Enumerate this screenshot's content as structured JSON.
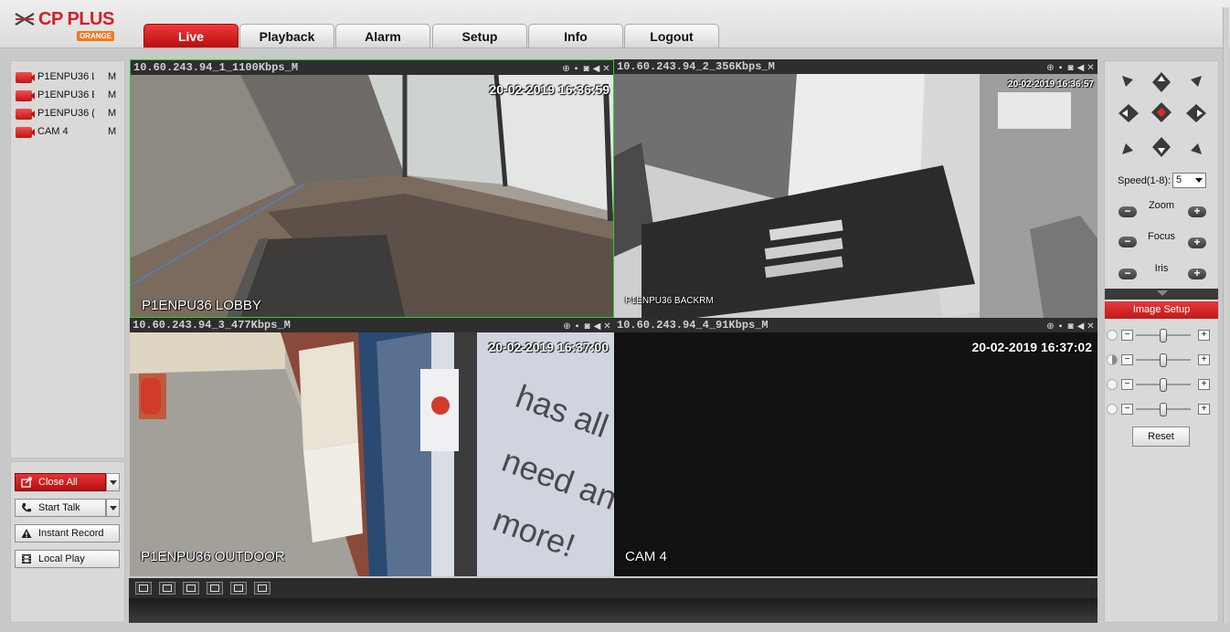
{
  "brand": {
    "name": "CP PLUS",
    "sub": "ORANGE"
  },
  "tabs": [
    {
      "label": "Live",
      "active": true
    },
    {
      "label": "Playback",
      "active": false
    },
    {
      "label": "Alarm",
      "active": false
    },
    {
      "label": "Setup",
      "active": false
    },
    {
      "label": "Info",
      "active": false
    },
    {
      "label": "Logout",
      "active": false
    }
  ],
  "cameras": [
    {
      "name": "P1ENPU36 L",
      "stream": "M",
      "icon": "camera-icon"
    },
    {
      "name": "P1ENPU36 E",
      "stream": "M",
      "icon": "camera-icon"
    },
    {
      "name": "P1ENPU36 (",
      "stream": "M",
      "icon": "camera-icon"
    },
    {
      "name": "CAM 4",
      "stream": "M",
      "icon": "camera-icon"
    }
  ],
  "controls": {
    "close_all": "Close All",
    "start_talk": "Start Talk",
    "instant_record": "Instant Record",
    "local_play": "Local Play"
  },
  "video": [
    {
      "header": "10.60.243.94_1_1100Kbps_M",
      "timestamp": "20-02-2019 16:36:59",
      "osd": "P1ENPU36 LOBBY",
      "selected": true
    },
    {
      "header": "10.60.243.94_2_356Kbps_M",
      "timestamp": "20-02-2019 16:36:57",
      "osd": "P1ENPU36 BACKRM",
      "selected": false
    },
    {
      "header": "10.60.243.94_3_477Kbps_M",
      "timestamp": "20-02-2019 16:37:00",
      "osd": "P1ENPU36 OUTDOOR",
      "selected": false
    },
    {
      "header": "10.60.243.94_4_91Kbps_M",
      "timestamp": "20-02-2019 16:37:02",
      "osd": "CAM 4",
      "selected": false
    }
  ],
  "ptz": {
    "speed_label": "Speed(1-8):",
    "speed_value": "5",
    "zoom": "Zoom",
    "focus": "Focus",
    "iris": "Iris"
  },
  "image_setup": {
    "title": "Image Setup",
    "sliders": [
      {
        "name": "brightness",
        "icon": "brightness-icon",
        "level": 0.5
      },
      {
        "name": "contrast",
        "icon": "contrast-icon",
        "level": 0.5
      },
      {
        "name": "saturation",
        "icon": "saturation-icon",
        "level": 0.5
      },
      {
        "name": "hue",
        "icon": "hue-icon",
        "level": 0.5
      }
    ],
    "reset": "Reset"
  },
  "colors": {
    "accent": "#d0202a",
    "selection": "#2ecc2e"
  }
}
